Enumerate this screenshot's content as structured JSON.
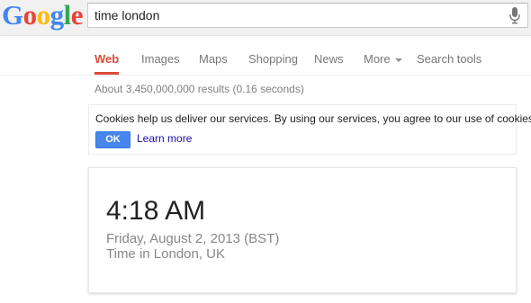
{
  "logo": {
    "letters": [
      "G",
      "o",
      "o",
      "g",
      "l",
      "e"
    ],
    "colors": [
      "#4285f4",
      "#ea4335",
      "#fbbc05",
      "#4285f4",
      "#34a853",
      "#ea4335"
    ]
  },
  "search": {
    "query": "time london",
    "mic_icon": "microphone-icon"
  },
  "nav": {
    "tabs": [
      {
        "label": "Web",
        "active": true
      },
      {
        "label": "Images"
      },
      {
        "label": "Maps"
      },
      {
        "label": "Shopping"
      },
      {
        "label": "News"
      },
      {
        "label": "More",
        "has_caret": true
      },
      {
        "label": "Search tools"
      }
    ],
    "active_color": "#dd4b39"
  },
  "result_stats": "About 3,450,000,000 results (0.16 seconds)",
  "cookie_notice": {
    "text": "Cookies help us deliver our services. By using our services, you agree to our use of cookies.",
    "ok_label": "OK",
    "learn_more_label": "Learn more",
    "button_color": "#4787ed"
  },
  "time_card": {
    "time": "4:18 AM",
    "date": "Friday, August 2, 2013 (BST)",
    "place": "Time in London, UK"
  }
}
